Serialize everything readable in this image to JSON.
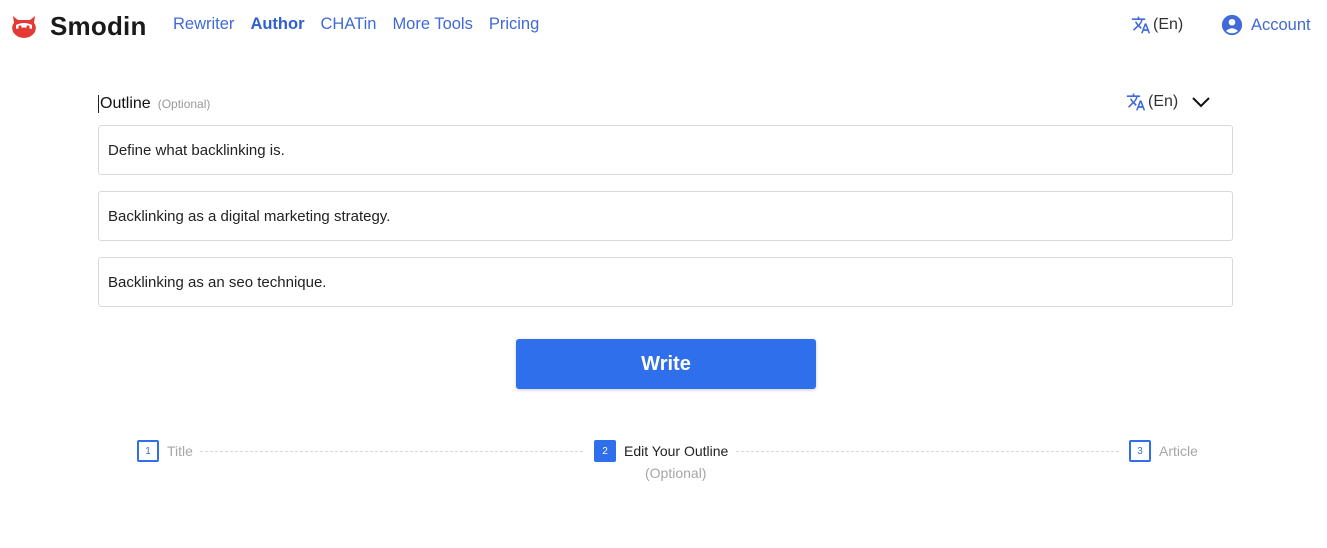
{
  "brand": {
    "name": "Smodin",
    "accent": "#e53935"
  },
  "nav": {
    "items": [
      {
        "label": "Rewriter",
        "active": false
      },
      {
        "label": "Author",
        "active": true
      },
      {
        "label": "CHATin",
        "active": false
      },
      {
        "label": "More Tools",
        "active": false
      },
      {
        "label": "Pricing",
        "active": false
      }
    ]
  },
  "header": {
    "language": "(En)",
    "account": "Account"
  },
  "outline": {
    "title": "Outline",
    "optional": "(Optional)",
    "language": "(En)",
    "items": [
      "Define what backlinking is.",
      "Backlinking as a digital marketing strategy.",
      "Backlinking as an seo technique."
    ]
  },
  "write_button": "Write",
  "steps": [
    {
      "number": "1",
      "label": "Title"
    },
    {
      "number": "2",
      "label": "Edit Your Outline",
      "sub": "(Optional)"
    },
    {
      "number": "3",
      "label": "Article"
    }
  ],
  "colors": {
    "primary": "#2f6fec",
    "link": "#3f6ad8"
  }
}
